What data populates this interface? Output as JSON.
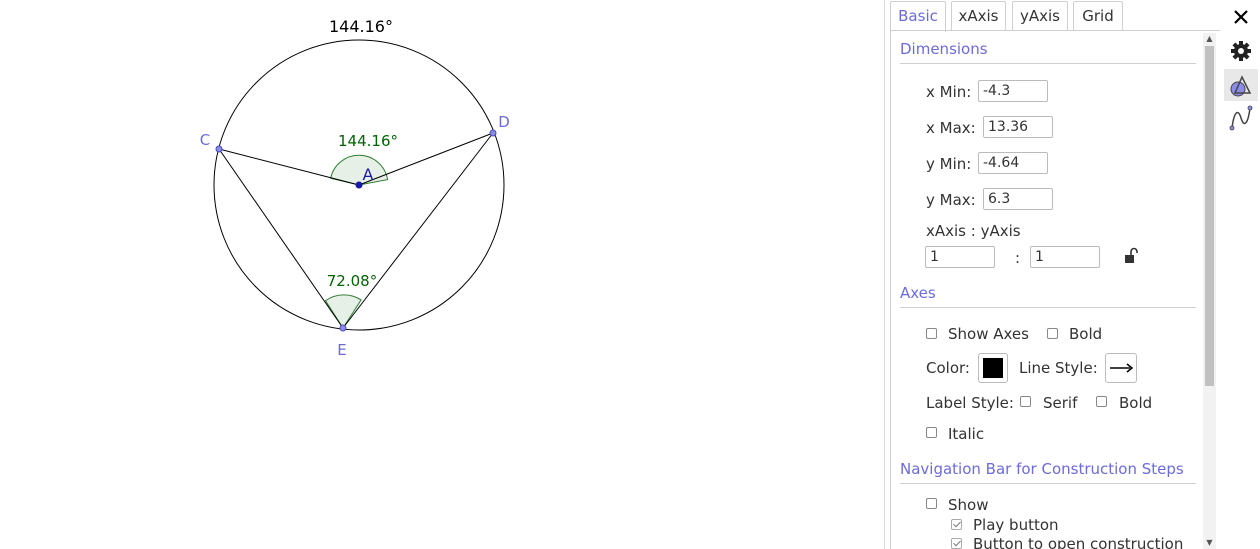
{
  "graphics": {
    "circle_top_label": "144.16°",
    "central_angle_label": "144.16°",
    "inscribed_angle_label": "72.08°",
    "point_labels": {
      "A": "A",
      "C": "C",
      "D": "D",
      "E": "E"
    },
    "colors": {
      "points": "#6b6bdb",
      "center_point": "#1a1aa6",
      "angle_text": "#006400",
      "angle_fill": "#e6f0e6"
    }
  },
  "panel": {
    "tabs": [
      {
        "label": "Basic",
        "active": true
      },
      {
        "label": "xAxis",
        "active": false
      },
      {
        "label": "yAxis",
        "active": false
      },
      {
        "label": "Grid",
        "active": false
      }
    ],
    "dimensions": {
      "title": "Dimensions",
      "x_min_label": "x Min:",
      "x_min_value": "-4.3",
      "x_max_label": "x Max:",
      "x_max_value": "13.36",
      "y_min_label": "y Min:",
      "y_min_value": "-4.64",
      "y_max_label": "y Max:",
      "y_max_value": "6.3",
      "ratio_label": "xAxis : yAxis",
      "ratio_x": "1",
      "ratio_sep": ":",
      "ratio_y": "1"
    },
    "axes": {
      "title": "Axes",
      "show_axes_label": "Show Axes",
      "bold_label": "Bold",
      "color_label": "Color:",
      "color_value": "#000000",
      "line_style_label": "Line Style:",
      "label_style_label": "Label Style:",
      "serif_label": "Serif",
      "label_bold_label": "Bold",
      "italic_label": "Italic"
    },
    "navigation": {
      "title": "Navigation Bar for Construction Steps",
      "show_label": "Show",
      "play_button_label": "Play button",
      "open_construction_label": "Button to open construction"
    },
    "accent_color": "#6b6bdb"
  }
}
